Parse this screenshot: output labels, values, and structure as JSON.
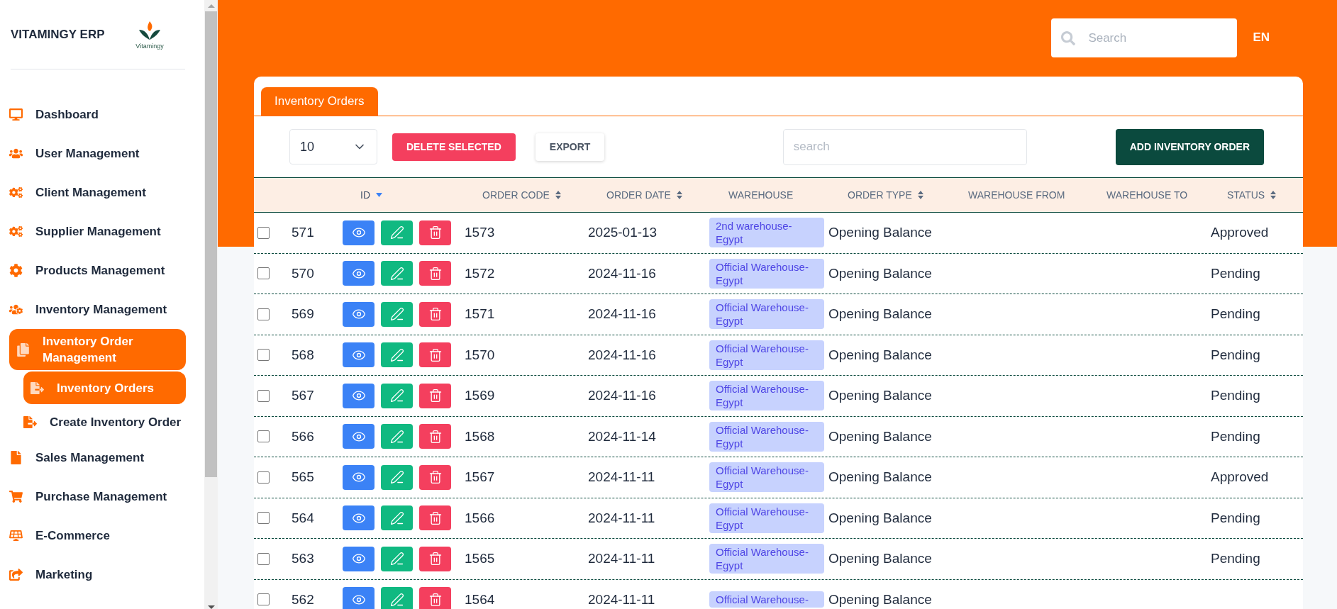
{
  "brand": {
    "title": "VITAMINGY ERP",
    "logo_text": "Vitamingy"
  },
  "sidebar": {
    "items": [
      {
        "label": "Dashboard",
        "selected": false
      },
      {
        "label": "User Management",
        "selected": false
      },
      {
        "label": "Client Management",
        "selected": false
      },
      {
        "label": "Supplier Management",
        "selected": false
      },
      {
        "label": "Products Management",
        "selected": false
      },
      {
        "label": "Inventory Management",
        "selected": false
      },
      {
        "label": "Inventory Order Management",
        "selected": true,
        "children": [
          {
            "label": "Inventory Orders",
            "selected": true
          },
          {
            "label": "Create Inventory Order",
            "selected": false
          }
        ]
      },
      {
        "label": "Sales Management",
        "selected": false
      },
      {
        "label": "Purchase Management",
        "selected": false
      },
      {
        "label": "E-Commerce",
        "selected": false
      },
      {
        "label": "Marketing",
        "selected": false
      }
    ]
  },
  "topbar": {
    "search": {
      "placeholder": "Search"
    },
    "language": "EN"
  },
  "tabs": [
    {
      "label": "Inventory Orders",
      "selected": true
    }
  ],
  "toolbar": {
    "page_size": "10",
    "delete_button": "DELETE SELECTED",
    "export_button": "EXPORT",
    "search": {
      "placeholder": "search"
    },
    "add_button": "ADD INVENTORY ORDER"
  },
  "table": {
    "columns": [
      {
        "label": "ID",
        "sortable": true,
        "sorted": true
      },
      {
        "label": "ORDER CODE",
        "sortable": true,
        "sorted": false
      },
      {
        "label": "ORDER DATE",
        "sortable": true,
        "sorted": false
      },
      {
        "label": "WAREHOUSE",
        "sortable": false
      },
      {
        "label": "ORDER TYPE",
        "sortable": true,
        "sorted": false
      },
      {
        "label": "WAREHOUSE FROM",
        "sortable": false
      },
      {
        "label": "WAREHOUSE TO",
        "sortable": false
      },
      {
        "label": "STATUS",
        "sortable": true,
        "sorted": false
      }
    ],
    "rows": [
      {
        "checked": false,
        "id": "571",
        "order_code": "1573",
        "order_date": "2025-01-13",
        "warehouse": "2nd warehouse-Egypt",
        "order_type": "Opening Balance",
        "status": "Approved"
      },
      {
        "checked": false,
        "id": "570",
        "order_code": "1572",
        "order_date": "2024-11-16",
        "warehouse": "Official Warehouse-Egypt",
        "order_type": "Opening Balance",
        "status": "Pending"
      },
      {
        "checked": false,
        "id": "569",
        "order_code": "1571",
        "order_date": "2024-11-16",
        "warehouse": "Official Warehouse-Egypt",
        "order_type": "Opening Balance",
        "status": "Pending"
      },
      {
        "checked": false,
        "id": "568",
        "order_code": "1570",
        "order_date": "2024-11-16",
        "warehouse": "Official Warehouse-Egypt",
        "order_type": "Opening Balance",
        "status": "Pending"
      },
      {
        "checked": false,
        "id": "567",
        "order_code": "1569",
        "order_date": "2024-11-16",
        "warehouse": "Official Warehouse-Egypt",
        "order_type": "Opening Balance",
        "status": "Pending"
      },
      {
        "checked": false,
        "id": "566",
        "order_code": "1568",
        "order_date": "2024-11-14",
        "warehouse": "Official Warehouse-Egypt",
        "order_type": "Opening Balance",
        "status": "Pending"
      },
      {
        "checked": false,
        "id": "565",
        "order_code": "1567",
        "order_date": "2024-11-11",
        "warehouse": "Official Warehouse-Egypt",
        "order_type": "Opening Balance",
        "status": "Approved"
      },
      {
        "checked": false,
        "id": "564",
        "order_code": "1566",
        "order_date": "2024-11-11",
        "warehouse": "Official Warehouse-Egypt",
        "order_type": "Opening Balance",
        "status": "Pending"
      },
      {
        "checked": false,
        "id": "563",
        "order_code": "1565",
        "order_date": "2024-11-11",
        "warehouse": "Official Warehouse-Egypt",
        "order_type": "Opening Balance",
        "status": "Pending"
      },
      {
        "checked": false,
        "id": "562",
        "order_code": "1564",
        "order_date": "2024-11-11",
        "warehouse": "Official Warehouse-",
        "order_type": "Opening Balance"
      }
    ]
  }
}
